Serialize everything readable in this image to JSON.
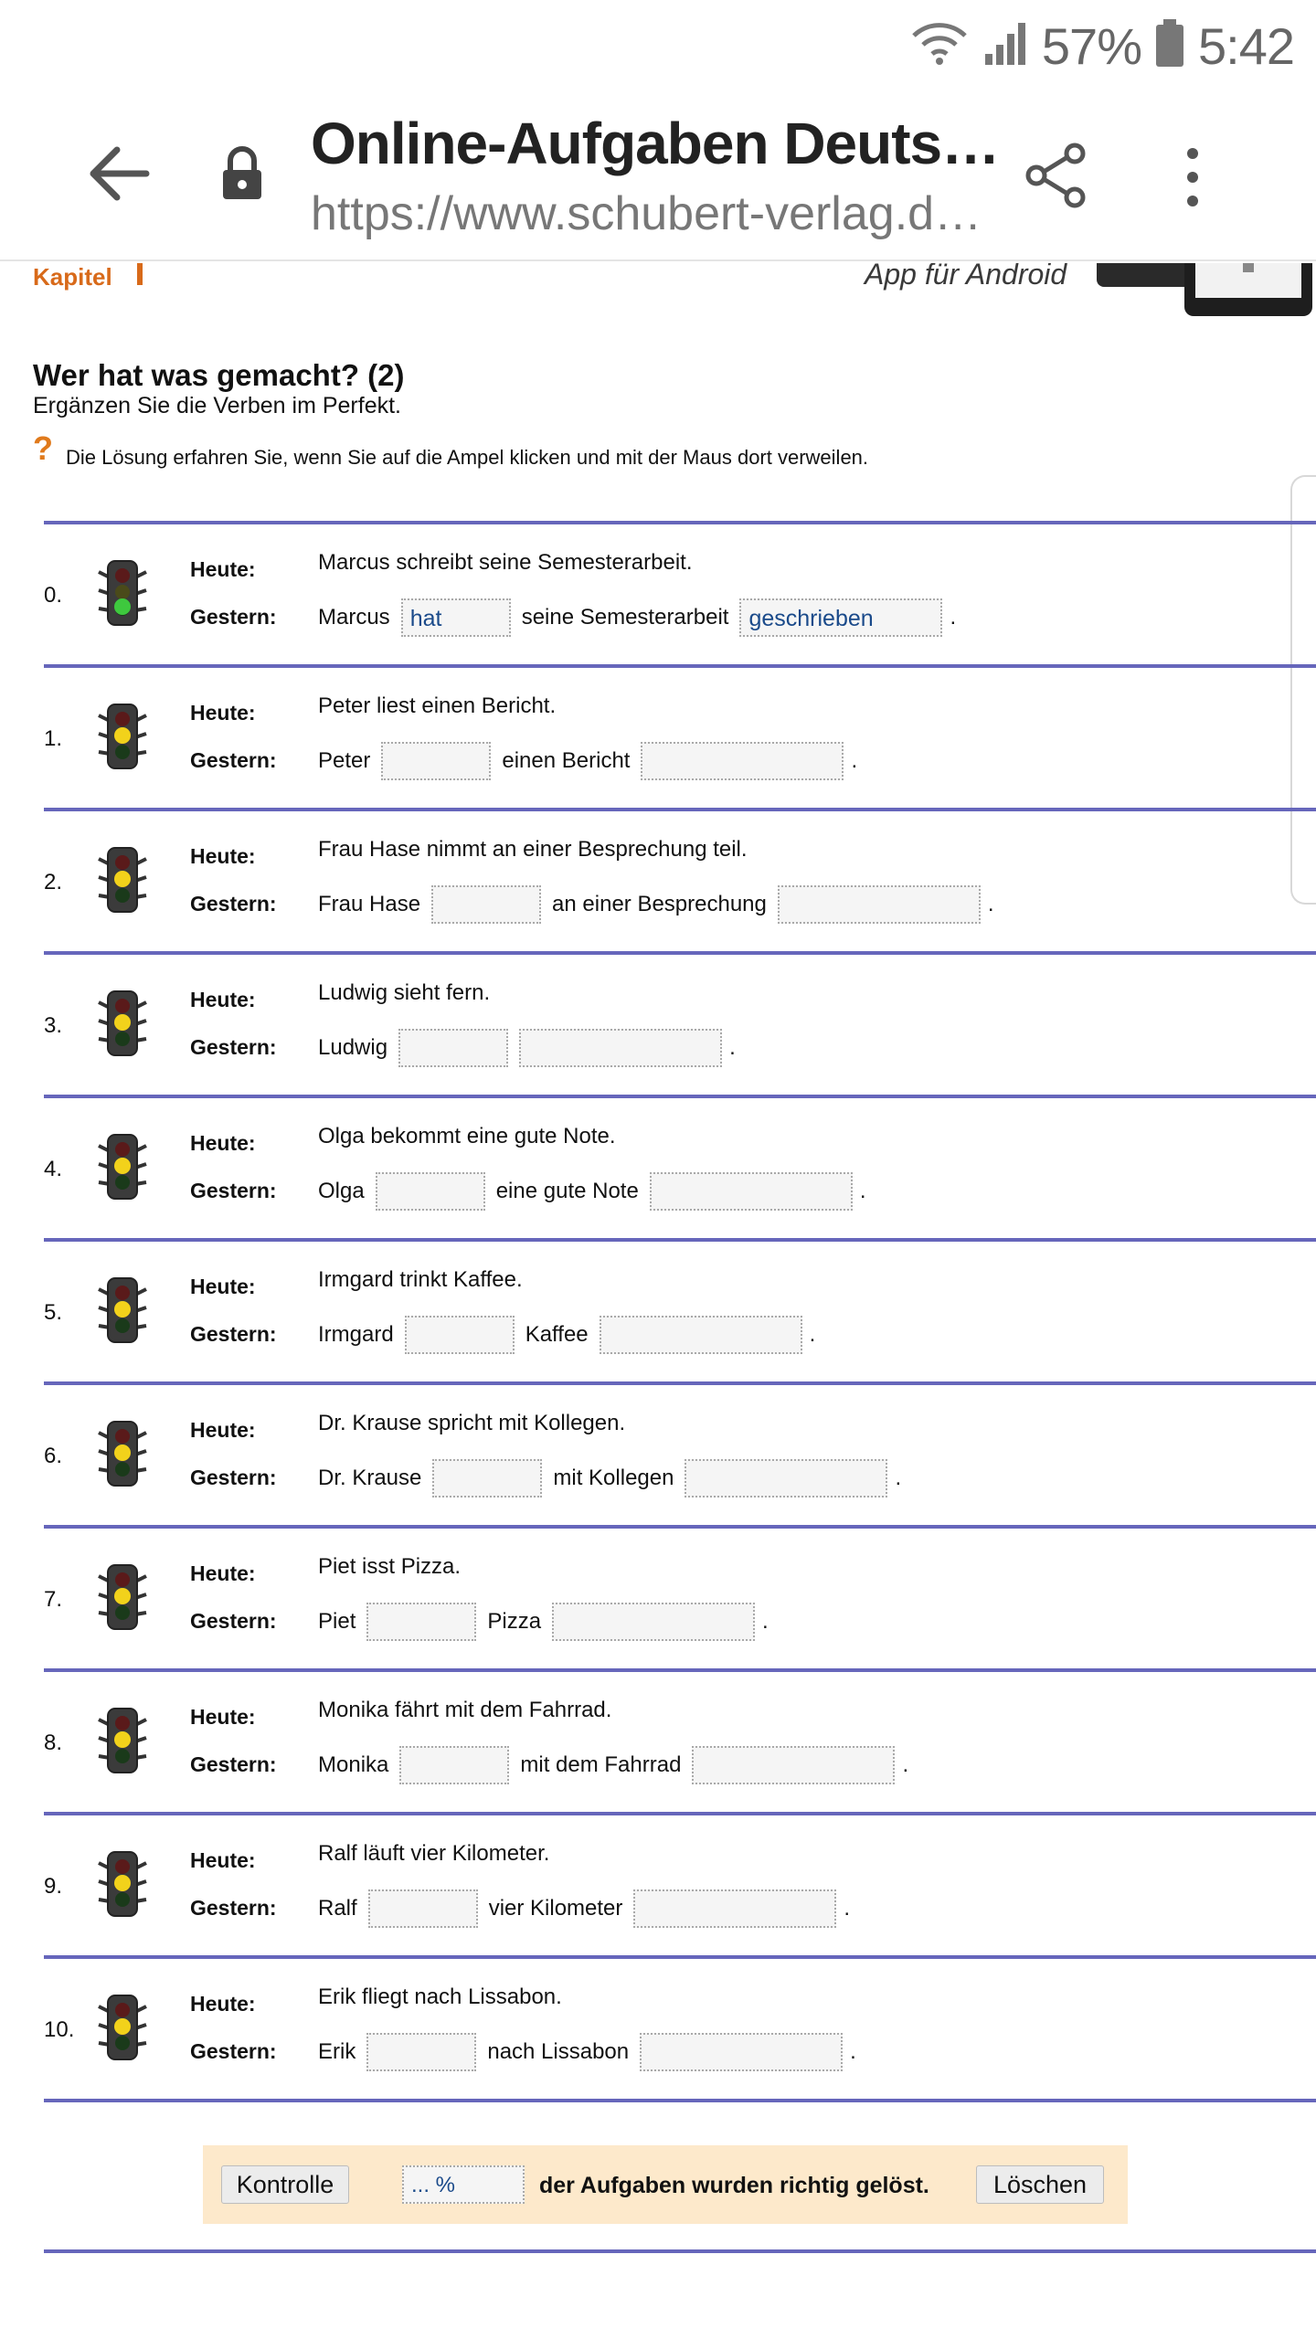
{
  "status_bar": {
    "battery": "57%",
    "time": "5:42"
  },
  "browser": {
    "title": "Online-Aufgaben Deutsch…",
    "url": "https://www.schubert-verlag.de/auf…"
  },
  "page": {
    "kapitel": "Kapitel",
    "app_banner_text": "App für Android",
    "title": "Wer hat was gemacht? (2)",
    "subtitle": "Ergänzen Sie die Verben im Perfekt.",
    "hint_icon": "?",
    "hint": "Die Lösung erfahren Sie, wenn Sie auf die Ampel klicken und mit der Maus dort verweilen.",
    "label_heute": "Heute:",
    "label_gestern": "Gestern:",
    "exercises": [
      {
        "num": "0.",
        "light": "green",
        "heute": "Marcus schreibt seine Semesterarbeit.",
        "subject": "Marcus",
        "middle": "seine Semesterarbeit",
        "aux_value": "hat",
        "part_value": "geschrieben"
      },
      {
        "num": "1.",
        "light": "yellow",
        "heute": "Peter liest einen Bericht.",
        "subject": "Peter",
        "middle": "einen Bericht",
        "aux_value": "",
        "part_value": ""
      },
      {
        "num": "2.",
        "light": "yellow",
        "heute": "Frau Hase nimmt an einer Besprechung teil.",
        "subject": "Frau Hase",
        "middle": "an einer Besprechung",
        "aux_value": "",
        "part_value": ""
      },
      {
        "num": "3.",
        "light": "yellow",
        "heute": "Ludwig sieht fern.",
        "subject": "Ludwig",
        "middle": "",
        "aux_value": "",
        "part_value": ""
      },
      {
        "num": "4.",
        "light": "yellow",
        "heute": "Olga bekommt eine gute Note.",
        "subject": "Olga",
        "middle": "eine gute Note",
        "aux_value": "",
        "part_value": ""
      },
      {
        "num": "5.",
        "light": "yellow",
        "heute": "Irmgard trinkt Kaffee.",
        "subject": "Irmgard",
        "middle": "Kaffee",
        "aux_value": "",
        "part_value": ""
      },
      {
        "num": "6.",
        "light": "yellow",
        "heute": "Dr. Krause spricht mit Kollegen.",
        "subject": "Dr. Krause",
        "middle": "mit Kollegen",
        "aux_value": "",
        "part_value": ""
      },
      {
        "num": "7.",
        "light": "yellow",
        "heute": "Piet isst Pizza.",
        "subject": "Piet",
        "middle": "Pizza",
        "aux_value": "",
        "part_value": ""
      },
      {
        "num": "8.",
        "light": "yellow",
        "heute": "Monika fährt mit dem Fahrrad.",
        "subject": "Monika",
        "middle": "mit dem Fahrrad",
        "aux_value": "",
        "part_value": ""
      },
      {
        "num": "9.",
        "light": "yellow",
        "heute": "Ralf läuft vier Kilometer.",
        "subject": "Ralf",
        "middle": "vier Kilometer",
        "aux_value": "",
        "part_value": ""
      },
      {
        "num": "10.",
        "light": "yellow",
        "heute": "Erik fliegt nach Lissabon.",
        "subject": "Erik",
        "middle": "nach Lissabon",
        "aux_value": "",
        "part_value": ""
      }
    ],
    "period": ".",
    "result": {
      "kontrolle_label": "Kontrolle",
      "percent_value": "... %",
      "text": "der Aufgaben wurden richtig gelöst.",
      "loeschen_label": "Löschen"
    }
  },
  "colors": {
    "accent_orange": "#d86a1a",
    "rule_blue": "#6666bb",
    "result_bg": "#fde9cb",
    "input_text": "#1a4a8a"
  }
}
